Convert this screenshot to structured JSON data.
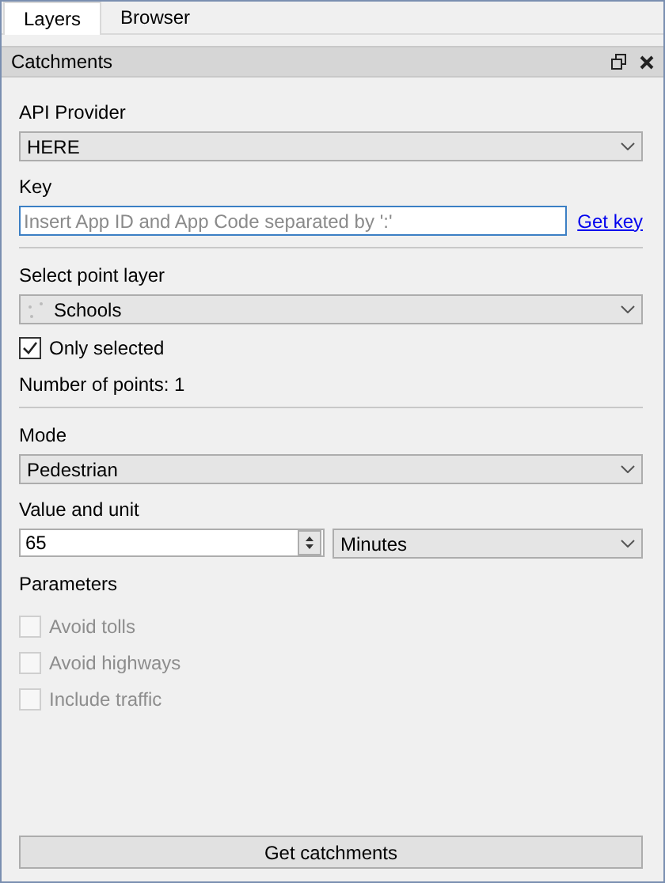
{
  "tabs": [
    {
      "label": "Layers",
      "selected": true
    },
    {
      "label": "Browser",
      "selected": false
    }
  ],
  "panel": {
    "title": "Catchments"
  },
  "provider": {
    "label": "API Provider",
    "value": "HERE"
  },
  "key": {
    "label": "Key",
    "placeholder": "Insert App ID and App Code separated by ':'",
    "link": "Get key"
  },
  "layer": {
    "label": "Select point layer",
    "value": "Schools"
  },
  "only_selected": {
    "label": "Only selected",
    "checked": true,
    "disabled": false
  },
  "points": "Number of points: 1",
  "mode": {
    "label": "Mode",
    "value": "Pedestrian"
  },
  "value_unit": {
    "label": "Value and unit",
    "value": "65",
    "unit": "Minutes"
  },
  "parameters": {
    "label": "Parameters",
    "items": [
      {
        "label": "Avoid tolls",
        "checked": false,
        "disabled": true
      },
      {
        "label": "Avoid highways",
        "checked": false,
        "disabled": true
      },
      {
        "label": "Include traffic",
        "checked": false,
        "disabled": true
      }
    ]
  },
  "button": "Get catchments"
}
